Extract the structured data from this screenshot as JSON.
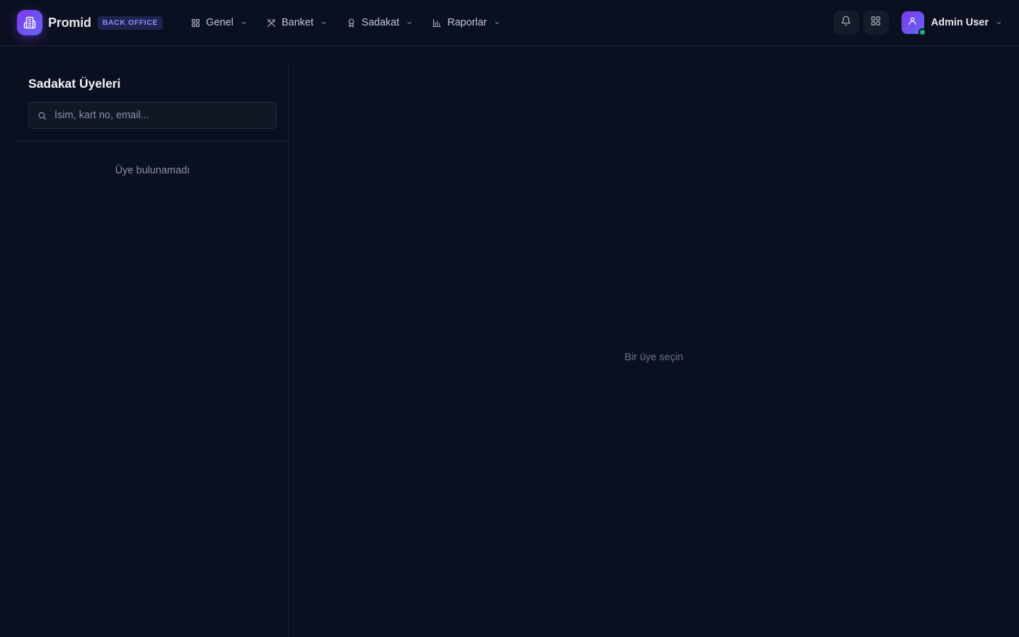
{
  "brand": {
    "name": "Promid",
    "badge": "BACK OFFICE"
  },
  "nav": {
    "items": [
      {
        "label": "Genel",
        "icon": "grid-icon"
      },
      {
        "label": "Banket",
        "icon": "utensils-icon"
      },
      {
        "label": "Sadakat",
        "icon": "award-icon"
      },
      {
        "label": "Raporlar",
        "icon": "bar-chart-icon"
      }
    ]
  },
  "header": {
    "notifications_icon": "bell-icon",
    "apps_icon": "apps-grid-icon",
    "user_name": "Admin User"
  },
  "sidebar": {
    "title": "Sadakat Üyeleri",
    "search_placeholder": "İsim, kart no, email...",
    "search_value": "",
    "empty_text": "Üye bulunamadı"
  },
  "main": {
    "empty_text": "Bir üye seçin"
  },
  "colors": {
    "background": "#0b1020",
    "accent": "#7c3aed",
    "badge_bg": "#1e2350",
    "badge_text": "#8b8ff5",
    "status_online": "#10b981"
  }
}
